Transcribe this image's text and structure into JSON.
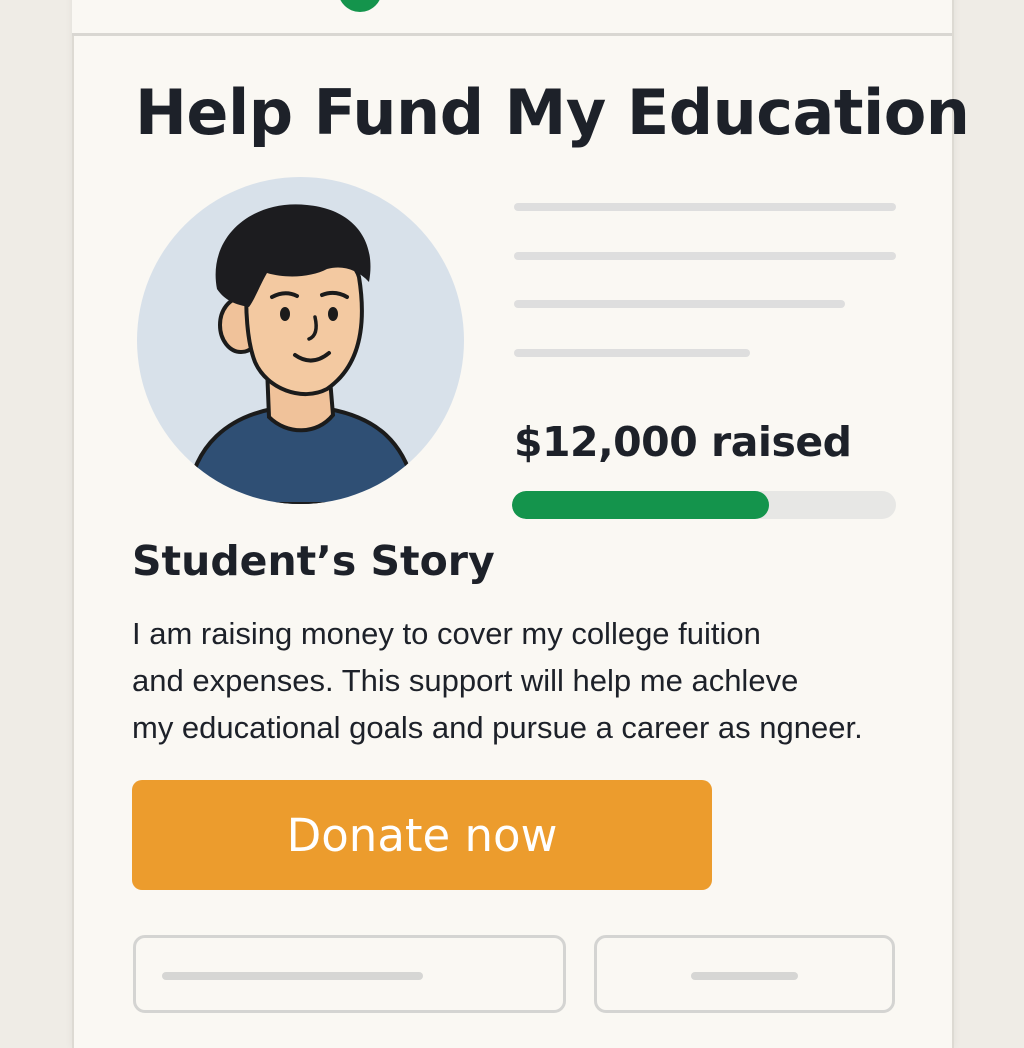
{
  "page": {
    "title": "Help Fund My Education"
  },
  "campaign": {
    "raised_text": "$12,000 raised",
    "progress_fraction": 0.67
  },
  "story": {
    "heading": "Student’s Story",
    "lines": [
      "I am raising money to cover my college fuition",
      "and expenses. This support will help me achleve",
      "my educational goals and pursue a career as ngneer."
    ]
  },
  "actions": {
    "donate_label": "Donate now"
  },
  "colors": {
    "accent_green": "#14944c",
    "donate_orange": "#ec9c2d",
    "text_dark": "#1d2129",
    "avatar_bg": "#d8e1ea"
  },
  "icons": {
    "avatar": "student-avatar-illustration"
  }
}
